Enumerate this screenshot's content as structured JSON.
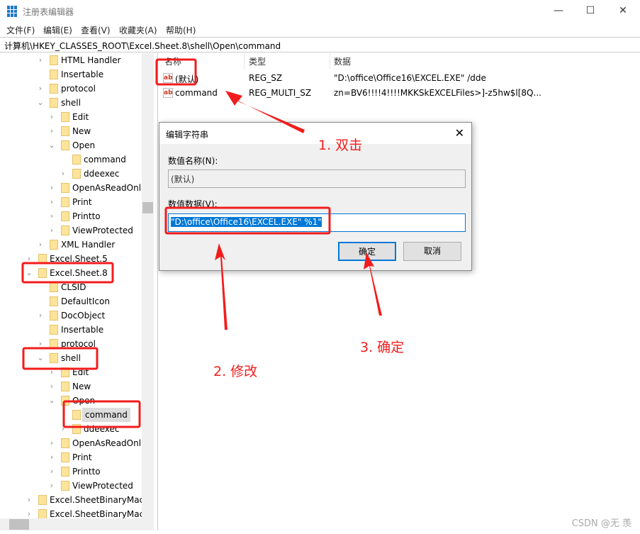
{
  "window": {
    "title": "注册表编辑器",
    "controls": [
      "—",
      "☐",
      "✕"
    ]
  },
  "menu": [
    "文件(F)",
    "编辑(E)",
    "查看(V)",
    "收藏夹(A)",
    "帮助(H)"
  ],
  "address": "计算机\\HKEY_CLASSES_ROOT\\Excel.Sheet.8\\shell\\Open\\command",
  "tree": [
    {
      "label": "HTML Handler",
      "level": 3,
      "chev": ">"
    },
    {
      "label": "Insertable",
      "level": 3,
      "chev": ""
    },
    {
      "label": "protocol",
      "level": 3,
      "chev": ">"
    },
    {
      "label": "shell",
      "level": 3,
      "chev": "v"
    },
    {
      "label": "Edit",
      "level": 4,
      "chev": ">"
    },
    {
      "label": "New",
      "level": 4,
      "chev": ">"
    },
    {
      "label": "Open",
      "level": 4,
      "chev": "v"
    },
    {
      "label": "command",
      "level": 5,
      "chev": ""
    },
    {
      "label": "ddeexec",
      "level": 5,
      "chev": ">"
    },
    {
      "label": "OpenAsReadOnl",
      "level": 4,
      "chev": ">"
    },
    {
      "label": "Print",
      "level": 4,
      "chev": ">"
    },
    {
      "label": "Printto",
      "level": 4,
      "chev": ">"
    },
    {
      "label": "ViewProtected",
      "level": 4,
      "chev": ">"
    },
    {
      "label": "XML Handler",
      "level": 3,
      "chev": ">"
    },
    {
      "label": "Excel.Sheet.5",
      "level": 2,
      "chev": ">"
    },
    {
      "label": "Excel.Sheet.8",
      "level": 2,
      "chev": "v"
    },
    {
      "label": "CLSID",
      "level": 3,
      "chev": ""
    },
    {
      "label": "DefaultIcon",
      "level": 3,
      "chev": ""
    },
    {
      "label": "DocObject",
      "level": 3,
      "chev": ">"
    },
    {
      "label": "Insertable",
      "level": 3,
      "chev": ""
    },
    {
      "label": "protocol",
      "level": 3,
      "chev": ">"
    },
    {
      "label": "shell",
      "level": 3,
      "chev": "v"
    },
    {
      "label": "Edit",
      "level": 4,
      "chev": ">"
    },
    {
      "label": "New",
      "level": 4,
      "chev": ">"
    },
    {
      "label": "Open",
      "level": 4,
      "chev": "v"
    },
    {
      "label": "command",
      "level": 5,
      "chev": "",
      "selected": true
    },
    {
      "label": "ddeexec",
      "level": 5,
      "chev": ">"
    },
    {
      "label": "OpenAsReadOnl",
      "level": 4,
      "chev": ">"
    },
    {
      "label": "Print",
      "level": 4,
      "chev": ">"
    },
    {
      "label": "Printto",
      "level": 4,
      "chev": ">"
    },
    {
      "label": "ViewProtected",
      "level": 4,
      "chev": ">"
    },
    {
      "label": "Excel.SheetBinaryMacı",
      "level": 2,
      "chev": ">"
    },
    {
      "label": "Excel.SheetBinaryMacı",
      "level": 2,
      "chev": ">"
    }
  ],
  "list": {
    "headers": [
      "名称",
      "类型",
      "数据"
    ],
    "rows": [
      {
        "name": "(默认)",
        "type": "REG_SZ",
        "data": "\"D:\\office\\Office16\\EXCEL.EXE\" /dde",
        "icon": "ab"
      },
      {
        "name": "command",
        "type": "REG_MULTI_SZ",
        "data": "zn=BV6!!!!4!!!!MKKSkEXCELFiles>]-z5hw$l[8Q...",
        "icon": "ab"
      }
    ]
  },
  "dialog": {
    "title": "编辑字符串",
    "name_label": "数值名称(N):",
    "name_value": "(默认)",
    "data_label": "数值数据(V):",
    "data_value": "\"D:\\office\\Office16\\EXCEL.EXE\" %1\"",
    "ok": "确定",
    "cancel": "取消"
  },
  "annotations": {
    "step1": "1. 双击",
    "step2": "2. 修改",
    "step3": "3. 确定",
    "color": "#f21c1c"
  },
  "watermark": "CSDN @无 羡"
}
